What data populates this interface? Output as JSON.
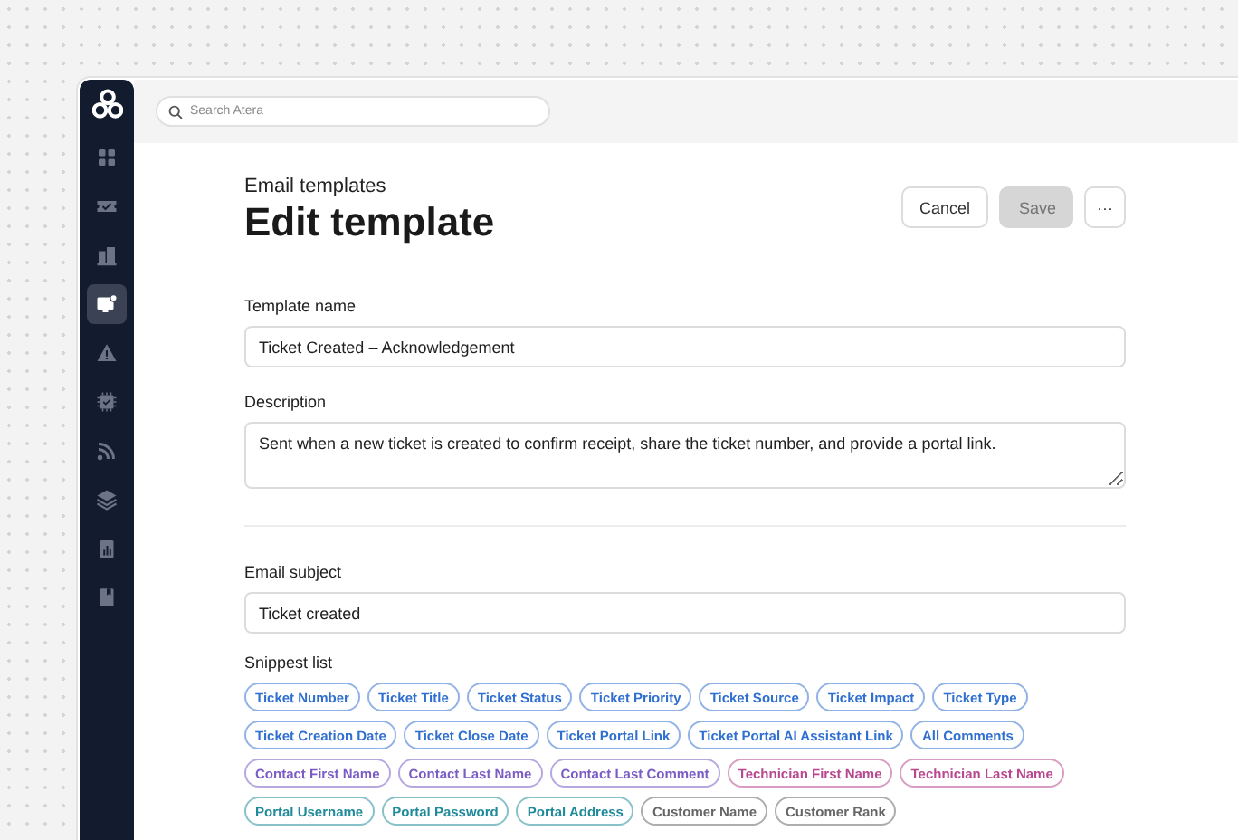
{
  "sidebar": {
    "items": [
      {
        "kind": "grid",
        "selected": false
      },
      {
        "kind": "ticket",
        "selected": false
      },
      {
        "kind": "building",
        "selected": false
      },
      {
        "kind": "monitor",
        "selected": true
      },
      {
        "kind": "warning",
        "selected": false
      },
      {
        "kind": "chip",
        "selected": false
      },
      {
        "kind": "feed",
        "selected": false
      },
      {
        "kind": "layers",
        "selected": false
      },
      {
        "kind": "report",
        "selected": false
      },
      {
        "kind": "book",
        "selected": false
      }
    ]
  },
  "search": {
    "placeholder": "Search Atera"
  },
  "header": {
    "breadcrumb": "Email templates",
    "title": "Edit template"
  },
  "actions": [
    {
      "kind": "cancel",
      "label": "Cancel",
      "disabled": false
    },
    {
      "kind": "save",
      "label": "Save",
      "disabled": true
    },
    {
      "kind": "more",
      "label": "···",
      "disabled": false
    }
  ],
  "fields": [
    {
      "kind": "input",
      "label": "Template name",
      "value": "Ticket Created – Acknowledgement"
    },
    {
      "kind": "textarea",
      "label": "Description",
      "value": "Sent when a new ticket is created to confirm receipt, share the ticket number, and provide a portal link."
    },
    {
      "kind": "divider"
    },
    {
      "kind": "input",
      "label": "Email subject",
      "value": "Ticket created"
    }
  ],
  "snippets": {
    "label": "Snippest list",
    "chips": [
      {
        "label": "Ticket Number",
        "color": "#2f6fd0"
      },
      {
        "label": "Ticket Title",
        "color": "#2f6fd0"
      },
      {
        "label": "Ticket Status",
        "color": "#2f6fd0"
      },
      {
        "label": "Ticket Priority",
        "color": "#2f6fd0"
      },
      {
        "label": "Ticket Source",
        "color": "#2f6fd0"
      },
      {
        "label": "Ticket Impact",
        "color": "#2f6fd0"
      },
      {
        "label": "Ticket Type",
        "color": "#2f6fd0"
      },
      {
        "label": "Ticket Creation Date",
        "color": "#2f6fd0"
      },
      {
        "label": "Ticket Close Date",
        "color": "#2f6fd0"
      },
      {
        "label": "Ticket Portal Link",
        "color": "#2f6fd0"
      },
      {
        "label": "Ticket Portal AI Assistant Link",
        "color": "#2f6fd0"
      },
      {
        "label": "All Comments",
        "color": "#2f6fd0"
      },
      {
        "label": "Contact First Name",
        "color": "#7a5cc4"
      },
      {
        "label": "Contact Last Name",
        "color": "#7a5cc4"
      },
      {
        "label": "Contact Last Comment",
        "color": "#7a5cc4"
      },
      {
        "label": "Technician First Name",
        "color": "#b8478f"
      },
      {
        "label": "Technician Last Name",
        "color": "#b8478f"
      },
      {
        "label": "Portal Username",
        "color": "#1f8a9a"
      },
      {
        "label": "Portal Password",
        "color": "#1f8a9a"
      },
      {
        "label": "Portal Address",
        "color": "#1f8a9a"
      },
      {
        "label": "Customer Name",
        "color": "#666666"
      },
      {
        "label": "Customer Rank",
        "color": "#666666"
      }
    ]
  }
}
